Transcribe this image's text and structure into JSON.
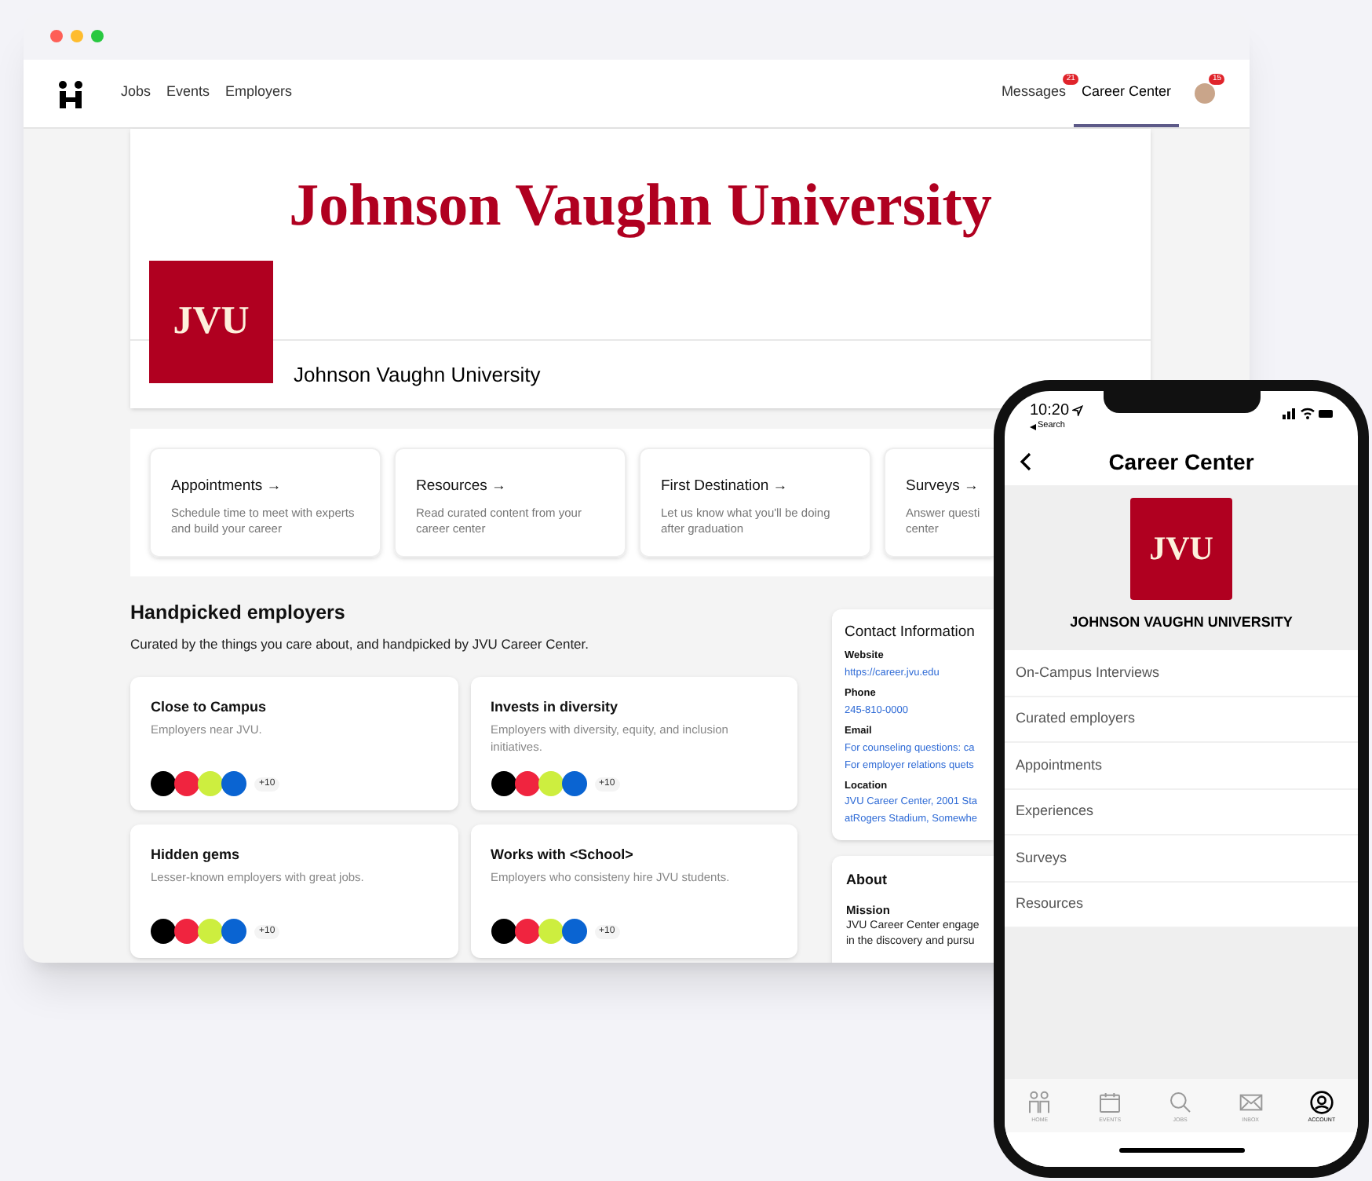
{
  "nav": {
    "links": [
      {
        "label": "Jobs",
        "selected": false
      },
      {
        "label": "Events",
        "selected": false
      },
      {
        "label": "Employers",
        "selected": false
      }
    ],
    "right": [
      {
        "label": "Messages",
        "badge": "21",
        "selected": false
      },
      {
        "label": "Career Center",
        "selected": true
      }
    ],
    "avatar_badge": "15"
  },
  "banner": {
    "title": "Johnson Vaughn University",
    "logo": "JVU",
    "name": "Johnson Vaughn University"
  },
  "quick_links": [
    {
      "title": "Appointments →",
      "description": "Schedule time to meet with experts and build your career"
    },
    {
      "title": "Resources →",
      "description": "Read curated content from your career center"
    },
    {
      "title": "First Destination →",
      "description": "Let us know what you'll be doing after graduation"
    },
    {
      "title": "Surveys →",
      "description": "Answer questi center"
    }
  ],
  "handpicked": {
    "heading": "Handpicked employers",
    "subtitle": "Curated by the things you care about, and handpicked by JVU Career Center.",
    "cards": [
      {
        "title": "Close to Campus",
        "description": "Employers near JVU.",
        "more": "+10",
        "logos": [
          {
            "color": "#000000"
          },
          {
            "color": "#f0243f"
          },
          {
            "color": "#cdee3f"
          },
          {
            "color": "#0a64d2"
          }
        ]
      },
      {
        "title": "Invests in diversity",
        "description": "Employers with diversity, equity, and inclusion initiatives.",
        "more": "+10",
        "logos": [
          {
            "color": "#000000"
          },
          {
            "color": "#f0243f"
          },
          {
            "color": "#cdee3f"
          },
          {
            "color": "#0a64d2"
          }
        ]
      },
      {
        "title": "Hidden gems",
        "description": "Lesser-known employers with great jobs.",
        "more": "+10",
        "logos": [
          {
            "color": "#000000"
          },
          {
            "color": "#f0243f"
          },
          {
            "color": "#cdee3f"
          },
          {
            "color": "#0a64d2"
          }
        ]
      },
      {
        "title": "Works with <School>",
        "description": "Employers who consisteny hire JVU students.",
        "more": "+10",
        "logos": [
          {
            "color": "#000000"
          },
          {
            "color": "#f0243f"
          },
          {
            "color": "#cdee3f"
          },
          {
            "color": "#0a64d2"
          }
        ]
      }
    ]
  },
  "contact": {
    "title": "Contact Information",
    "fields": [
      {
        "label": "Website",
        "lines": [
          "https://career.jvu.edu"
        ]
      },
      {
        "label": "Phone",
        "lines": [
          "245-810-0000"
        ]
      },
      {
        "label": "Email",
        "lines": [
          "For counseling questions: ca",
          "For employer relations quets"
        ]
      },
      {
        "label": "Location",
        "lines": [
          "JVU Career Center, 2001 Sta",
          "atRogers Stadium, Somewhe"
        ]
      }
    ]
  },
  "about": {
    "title": "About",
    "subtitle": "Mission",
    "lines": [
      "JVU Career Center engage",
      "in the discovery and pursu"
    ]
  },
  "phone": {
    "time": "10:20",
    "back_label": "Search",
    "title": "Career Center",
    "logo": "JVU",
    "school": "JOHNSON VAUGHN UNIVERSITY",
    "menu": [
      "On-Campus Interviews",
      "Curated employers",
      "Appointments",
      "Experiences",
      "Surveys",
      "Resources"
    ],
    "tabs": [
      {
        "kind": "home",
        "label": "HOME",
        "selected": false
      },
      {
        "kind": "events",
        "label": "EVENTS",
        "selected": false
      },
      {
        "kind": "jobs",
        "label": "JOBS",
        "selected": false
      },
      {
        "kind": "inbox",
        "label": "INBOX",
        "selected": false
      },
      {
        "kind": "account",
        "label": "ACCOUNT",
        "selected": true
      }
    ]
  }
}
